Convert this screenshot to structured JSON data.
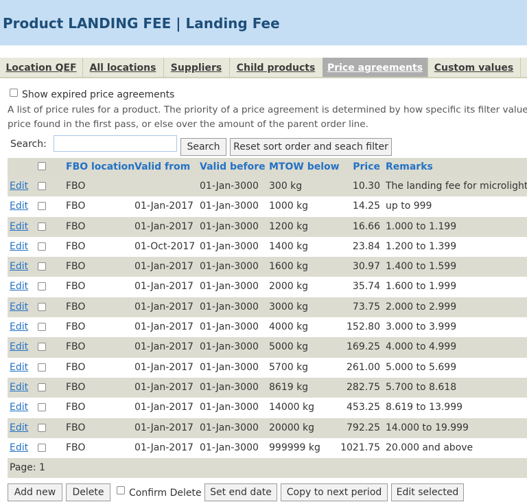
{
  "header": {
    "title": "Product LANDING FEE | Landing Fee"
  },
  "tabs": [
    {
      "label": "Location QEF",
      "active": false
    },
    {
      "label": "All locations",
      "active": false
    },
    {
      "label": "Suppliers",
      "active": false
    },
    {
      "label": "Child products",
      "active": false
    },
    {
      "label": "Price agreements",
      "active": true
    },
    {
      "label": "Custom values",
      "active": false
    }
  ],
  "filters": {
    "show_expired_label": "Show expired price agreements"
  },
  "description": {
    "line1": "A list of price rules for a product. The priority of a price agreement is determined by how specific its filter values",
    "line2": "price found in the first pass, or else over the amount of the parent order line."
  },
  "search": {
    "label": "Search:",
    "value": "",
    "placeholder": "",
    "button": "Search",
    "reset_button": "Reset sort order and seach filter"
  },
  "table": {
    "columns": {
      "fbo_location": "FBO location",
      "valid_from": "Valid from",
      "valid_before": "Valid before",
      "mtow_below": "MTOW below",
      "price": "Price",
      "remarks": "Remarks"
    },
    "edit_label": "Edit",
    "rows": [
      {
        "fbo_location": "FBO",
        "valid_from": "",
        "valid_before": "01-Jan-3000",
        "mtow_below": "300 kg",
        "price": "10.30",
        "remarks": "The landing fee for microlight"
      },
      {
        "fbo_location": "FBO",
        "valid_from": "01-Jan-2017",
        "valid_before": "01-Jan-3000",
        "mtow_below": "1000 kg",
        "price": "14.25",
        "remarks": "up to 999"
      },
      {
        "fbo_location": "FBO",
        "valid_from": "01-Jan-2017",
        "valid_before": "01-Jan-3000",
        "mtow_below": "1200 kg",
        "price": "16.66",
        "remarks": "1.000 to 1.199"
      },
      {
        "fbo_location": "FBO",
        "valid_from": "01-Oct-2017",
        "valid_before": "01-Jan-3000",
        "mtow_below": "1400 kg",
        "price": "23.84",
        "remarks": "1.200 to 1.399"
      },
      {
        "fbo_location": "FBO",
        "valid_from": "01-Jan-2017",
        "valid_before": "01-Jan-3000",
        "mtow_below": "1600 kg",
        "price": "30.97",
        "remarks": "1.400 to 1.599"
      },
      {
        "fbo_location": "FBO",
        "valid_from": "01-Jan-2017",
        "valid_before": "01-Jan-3000",
        "mtow_below": "2000 kg",
        "price": "35.74",
        "remarks": "1.600 to 1.999"
      },
      {
        "fbo_location": "FBO",
        "valid_from": "01-Jan-2017",
        "valid_before": "01-Jan-3000",
        "mtow_below": "3000 kg",
        "price": "73.75",
        "remarks": "2.000 to 2.999"
      },
      {
        "fbo_location": "FBO",
        "valid_from": "01-Jan-2017",
        "valid_before": "01-Jan-3000",
        "mtow_below": "4000 kg",
        "price": "152.80",
        "remarks": "3.000 to 3.999"
      },
      {
        "fbo_location": "FBO",
        "valid_from": "01-Jan-2017",
        "valid_before": "01-Jan-3000",
        "mtow_below": "5000 kg",
        "price": "169.25",
        "remarks": "4.000 to 4.999"
      },
      {
        "fbo_location": "FBO",
        "valid_from": "01-Jan-2017",
        "valid_before": "01-Jan-3000",
        "mtow_below": "5700 kg",
        "price": "261.00",
        "remarks": "5.000 to 5.699"
      },
      {
        "fbo_location": "FBO",
        "valid_from": "01-Jan-2017",
        "valid_before": "01-Jan-3000",
        "mtow_below": "8619 kg",
        "price": "282.75",
        "remarks": "5.700 to 8.618"
      },
      {
        "fbo_location": "FBO",
        "valid_from": "01-Jan-2017",
        "valid_before": "01-Jan-3000",
        "mtow_below": "14000 kg",
        "price": "453.25",
        "remarks": "8.619 to 13.999"
      },
      {
        "fbo_location": "FBO",
        "valid_from": "01-Jan-2017",
        "valid_before": "01-Jan-3000",
        "mtow_below": "20000 kg",
        "price": "792.25",
        "remarks": "14.000 to 19.999"
      },
      {
        "fbo_location": "FBO",
        "valid_from": "01-Jan-2017",
        "valid_before": "01-Jan-3000",
        "mtow_below": "999999 kg",
        "price": "1021.75",
        "remarks": "20.000 and above"
      }
    ]
  },
  "pager": {
    "text": "Page: 1"
  },
  "actions": {
    "add_new": "Add new",
    "delete": "Delete",
    "confirm_delete": "Confirm Delete",
    "set_end_date": "Set end date",
    "copy_next_period": "Copy to next period",
    "edit_selected": "Edit selected"
  },
  "colors": {
    "header_bg": "#c5def4",
    "title": "#1e4e79",
    "link": "#2372c4",
    "row_alt": "#dddcd0",
    "tab_active": "#adadad"
  }
}
